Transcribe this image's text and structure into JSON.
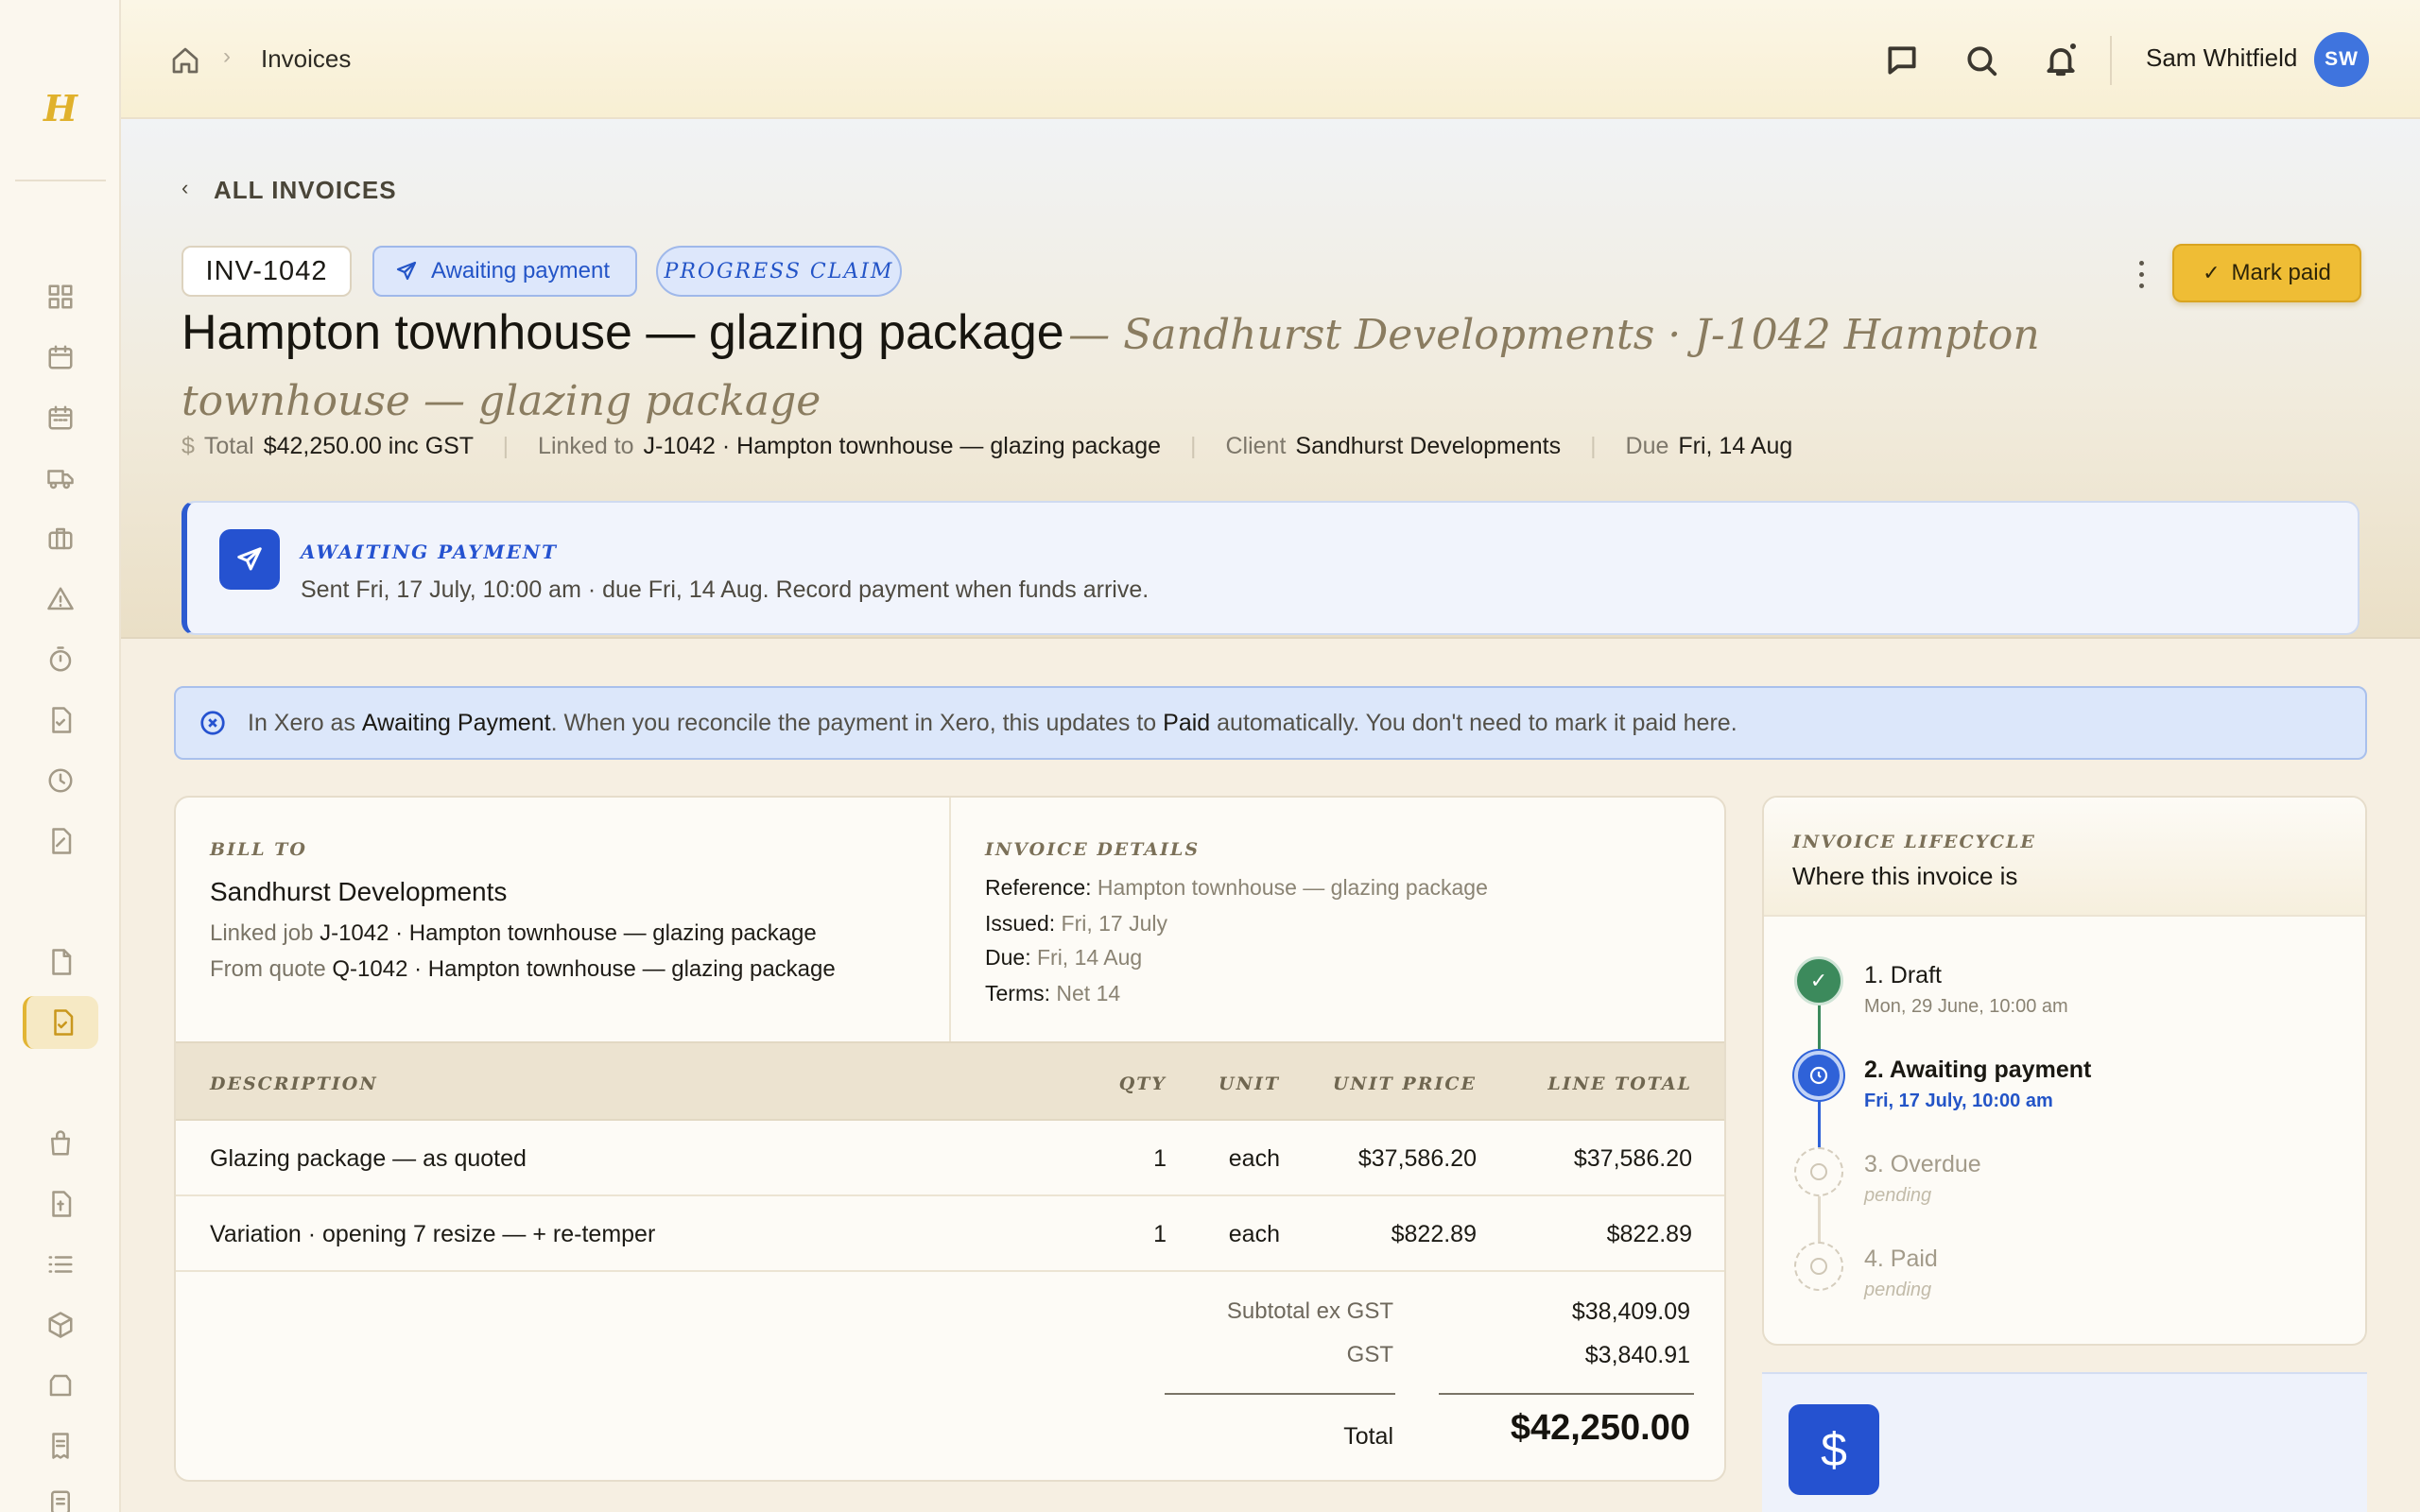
{
  "app": {
    "logo": "H"
  },
  "topbar": {
    "breadcrumb_page": "Invoices",
    "user_name": "Sam Whitfield",
    "user_initials": "SW"
  },
  "header": {
    "back_label": "ALL INVOICES",
    "invoice_number": "INV-1042",
    "status_chip": "Awaiting payment",
    "type_chip": "PROGRESS CLAIM",
    "mark_paid_label": "Mark paid",
    "title": "Hampton townhouse — glazing package",
    "subtitle": "— Sandhurst Developments · J-1042 Hampton townhouse — glazing package",
    "meta": {
      "total_label": "Total",
      "total_value": "$42,250.00 inc GST",
      "linked_label": "Linked to",
      "linked_value": "J-1042 · Hampton townhouse — glazing package",
      "client_label": "Client",
      "client_value": "Sandhurst Developments",
      "due_label": "Due",
      "due_value": "Fri, 14 Aug"
    },
    "banner": {
      "title": "AWAITING PAYMENT",
      "text": "Sent Fri, 17 July, 10:00 am · due Fri, 14 Aug. Record payment when funds arrive."
    }
  },
  "xero_notice": {
    "p1": "In Xero as ",
    "b1": "Awaiting Payment",
    "p2": ". When you reconcile the payment in Xero, this updates to ",
    "b2": "Paid",
    "p3": " automatically. You don't need to mark it paid here."
  },
  "invoice": {
    "bill_to_label": "BILL TO",
    "bill_to_name": "Sandhurst Developments",
    "linked_job_label": "Linked job",
    "linked_job_value": "J-1042 · Hampton townhouse — glazing package",
    "from_quote_label": "From quote",
    "from_quote_value": "Q-1042 · Hampton townhouse — glazing package",
    "details_label": "INVOICE DETAILS",
    "reference_label": "Reference:",
    "reference_value": "Hampton townhouse — glazing package",
    "issued_label": "Issued:",
    "issued_value": "Fri, 17 July",
    "due_label": "Due:",
    "due_value": "Fri, 14 Aug",
    "terms_label": "Terms:",
    "terms_value": "Net 14",
    "columns": [
      "DESCRIPTION",
      "QTY",
      "UNIT",
      "UNIT PRICE",
      "LINE TOTAL"
    ],
    "lines": [
      {
        "description": "Glazing package — as quoted",
        "qty": "1",
        "unit": "each",
        "unit_price": "$37,586.20",
        "line_total": "$37,586.20"
      },
      {
        "description": "Variation · opening 7 resize — + re-temper",
        "qty": "1",
        "unit": "each",
        "unit_price": "$822.89",
        "line_total": "$822.89"
      }
    ],
    "subtotal_label": "Subtotal ex GST",
    "subtotal_value": "$38,409.09",
    "gst_label": "GST",
    "gst_value": "$3,840.91",
    "total_label": "Total",
    "total_value": "$42,250.00"
  },
  "lifecycle": {
    "label": "INVOICE LIFECYCLE",
    "title": "Where this invoice is",
    "steps": [
      {
        "name": "1. Draft",
        "sub": "Mon, 29 June, 10:00 am",
        "state": "done"
      },
      {
        "name": "2. Awaiting payment",
        "sub": "Fri, 17 July, 10:00 am",
        "state": "current"
      },
      {
        "name": "3. Overdue",
        "sub": "pending",
        "state": "pending"
      },
      {
        "name": "4. Paid",
        "sub": "pending",
        "state": "pending"
      }
    ]
  },
  "payment_card": {
    "icon": "dollar-icon"
  },
  "colors": {
    "accent_gold": "#efbd35",
    "accent_blue": "#2552d0",
    "done_green": "#3c8a5c"
  }
}
